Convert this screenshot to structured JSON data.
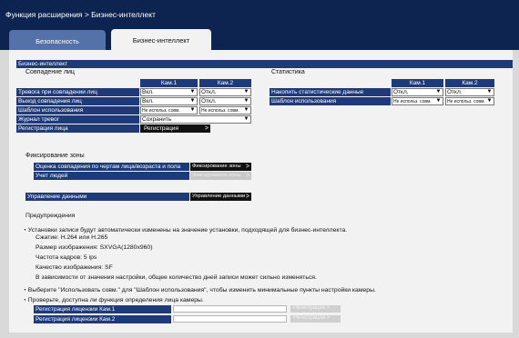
{
  "breadcrumb": "Функция расширения > Бизнес-интеллект",
  "tabs": {
    "security": "Безопасность",
    "bi": "Бизнес-интеллект"
  },
  "section_title": "Бизнес-интеллект",
  "face": {
    "heading": "Совпадение лиц",
    "cam1": "Кам.1",
    "cam2": "Кам.2",
    "rows": [
      {
        "label": "Тревога при совпадении лиц",
        "cam1": "Вкл.",
        "cam2": "Откл."
      },
      {
        "label": "Выход совпадения лиц",
        "cam1": "Вкл.",
        "cam2": "Откл."
      },
      {
        "label": "Шаблон использования",
        "cam1": "Не использ. совм.",
        "cam2": "Не использ. совм."
      }
    ],
    "log_label": "Журнал тревог",
    "log_value": "Сохранить",
    "reg_label": "Регистрация лица",
    "reg_button": "Регистрация"
  },
  "stats": {
    "heading": "Статистика",
    "cam1": "Кам.1",
    "cam2": "Кам.2",
    "rows": [
      {
        "label": "Накопить статистические данные",
        "cam1": "Откл.",
        "cam2": "Откл."
      },
      {
        "label": "Шаблон использования",
        "cam1": "Не использ. совм.",
        "cam2": "Не использ. совм."
      }
    ]
  },
  "zone": {
    "heading": "Фиксирование зоны",
    "row1_label": "Оценка совпадения по чертам лица/возраста и пола",
    "row1_button": "Фиксирование зоны",
    "row2_label": "Учет людей",
    "row2_button": "Фиксирование зоны"
  },
  "data_mgmt": {
    "label": "Управление данными",
    "button": "Управление данными"
  },
  "warnings": {
    "heading": "Предупреждения",
    "line1": "・Установки записи будут автоматически изменены на значение установки, подходящей для бизнес-интеллекта.",
    "line2": "Сжатие: H.264 или H.265",
    "line3": "Размер изображения: SXVGA(1280x960)",
    "line4": "Частота кадров: 5 ips",
    "line5": "Качество изображения: SF",
    "line6": "В зависимости от значения настройки, общее количество дней записи может сильно изменяться.",
    "line7": "・Выберите \"Использовать совм.\" для \"Шаблон использования\", чтобы изменить минимальные пункты настройки камеры.",
    "line8": "・Проверьте, доступна ли функция определения лица камеры."
  },
  "license": {
    "row1_label": "Регистрация лицензии Кам.1",
    "row2_label": "Регистрация лицензии Кам.2",
    "button": "Регистрация"
  }
}
